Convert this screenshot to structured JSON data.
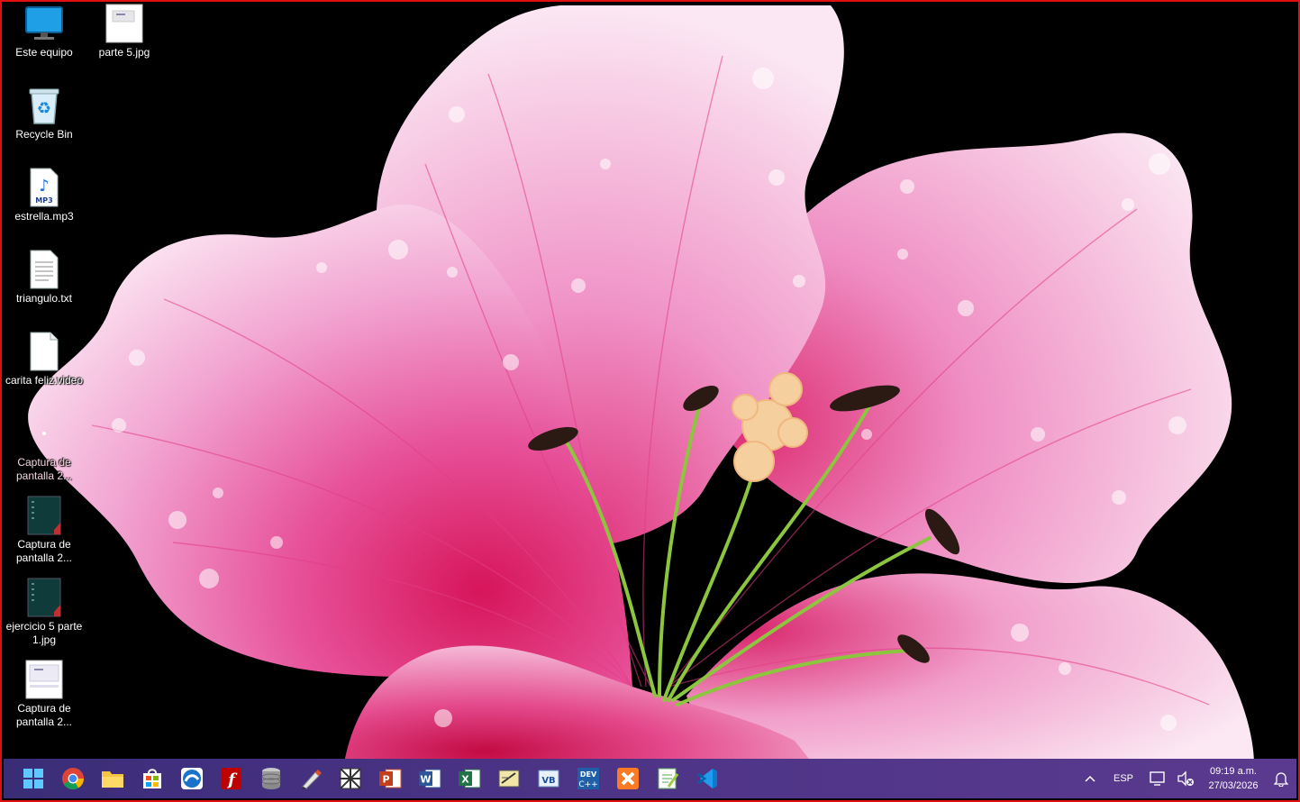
{
  "desktop": {
    "icons": [
      {
        "label": "Este equipo",
        "icon": "computer-monitor-icon"
      },
      {
        "label": "parte 5.jpg",
        "icon": "image-thumbnail-icon"
      },
      {
        "label": "Recycle Bin",
        "icon": "recycle-bin-icon"
      },
      {
        "label": "estrella.mp3",
        "icon": "mp3-file-icon"
      },
      {
        "label": "triangulo.txt",
        "icon": "text-file-icon"
      },
      {
        "label": "carita feliz.video",
        "icon": "blank-file-icon"
      },
      {
        "label": "Captura de pantalla 2...",
        "icon": "image-thumbnail-icon"
      },
      {
        "label": "Captura de pantalla 2...",
        "icon": "dark-image-thumbnail-icon"
      },
      {
        "label": "ejercicio 5 parte 1.jpg",
        "icon": "dark-image-thumbnail-icon"
      },
      {
        "label": "Captura de pantalla 2...",
        "icon": "image-thumbnail-icon"
      }
    ]
  },
  "taskbar": {
    "apps": [
      "windows-start-icon",
      "chrome-icon",
      "file-explorer-icon",
      "microsoft-store-icon",
      "app-blue-circle-icon",
      "filezilla-icon",
      "database-icon",
      "pen-tool-icon",
      "pattern-app-icon",
      "powerpoint-icon",
      "word-icon",
      "excel-icon",
      "edit-tool-icon",
      "visual-basic-icon",
      "dev-cpp-icon",
      "xampp-icon",
      "notepad-plus-icon",
      "vscode-icon"
    ],
    "tray": {
      "language": "ESP",
      "time": "09:19 a.m.",
      "date": "27/03/2026"
    }
  },
  "colors": {
    "taskbar": "#4d3486",
    "desktop_border": "#e01010",
    "wallpaper_bg": "#000000",
    "flower_pink": "#f5a8d0"
  }
}
